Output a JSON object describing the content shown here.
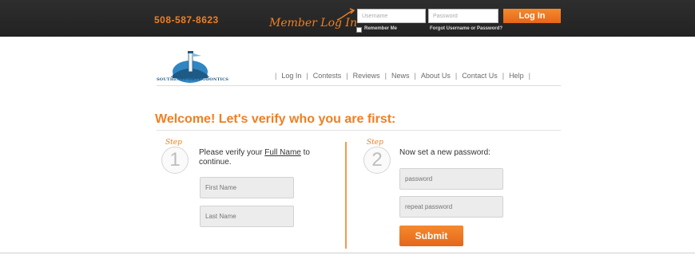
{
  "topbar": {
    "phone": "508-587-8623",
    "member_login_label": "Member Log In",
    "username_placeholder": "Username",
    "password_placeholder": "Password",
    "login_button": "Log In",
    "remember_me": "Remember Me",
    "forgot_link": "Forgot Username or Password?"
  },
  "brand": {
    "logo_text": "SOUTHEAST ORTHODONTICS",
    "accent_color": "#f07f22"
  },
  "nav": {
    "items": [
      "Log In",
      "Contests",
      "Reviews",
      "News",
      "About Us",
      "Contact Us",
      "Help"
    ]
  },
  "main": {
    "heading": "Welcome! Let's verify who you are first:",
    "step1": {
      "step_word": "Step",
      "number": "1",
      "text_before": "Please verify your ",
      "link_text": "Full Name",
      "text_after": " to continue.",
      "first_name_placeholder": "First Name",
      "last_name_placeholder": "Last Name"
    },
    "step2": {
      "step_word": "Step",
      "number": "2",
      "text": "Now set a new password:",
      "password_placeholder": "password",
      "repeat_placeholder": "repeat password",
      "submit_button": "Submit"
    }
  }
}
